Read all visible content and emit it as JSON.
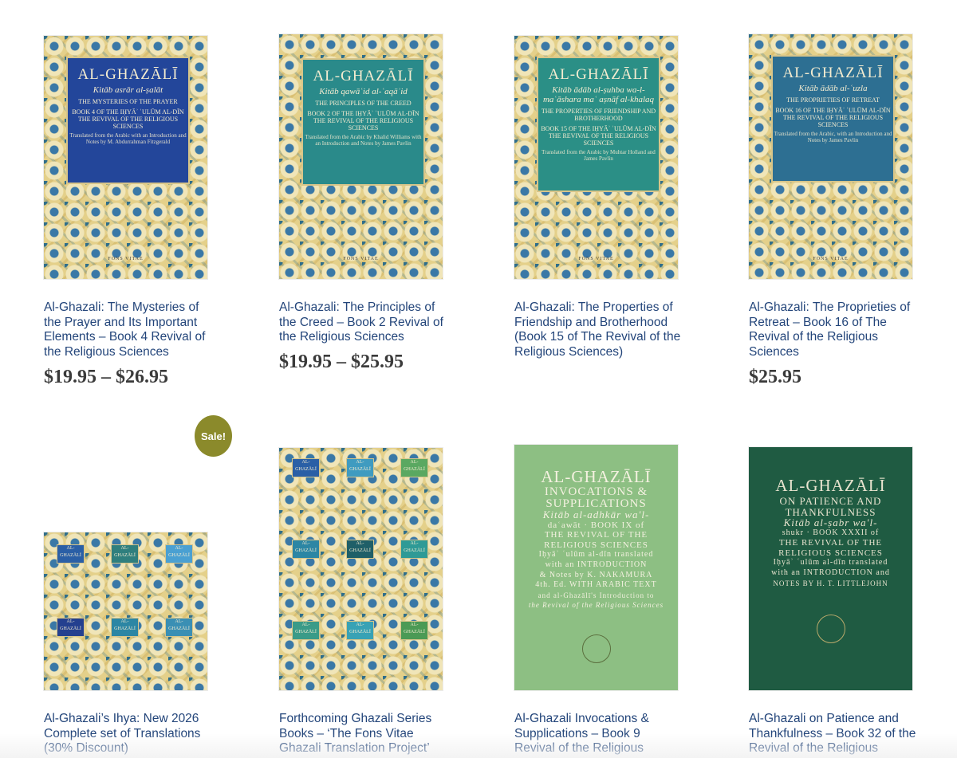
{
  "products": [
    {
      "title": "Al-Ghazali: The Mysteries of the Prayer and Its Important Elements – Book 4 Revival of the Religious Sciences",
      "price": "$19.95 – $26.95",
      "cover": {
        "author": "AL-GHAZĀLĪ",
        "subtitle": "Kitāb asrār al-ṣalāt",
        "heading": "THE MYSTERIES OF THE PRAYER",
        "series": "Book 4 of the Iḥyāʾ ʿulūm al-dīn THE REVIVAL OF THE RELIGIOUS SCIENCES",
        "credit": "Translated from the Arabic with an Introduction and Notes by M. Abdurrahman Fitzgerald",
        "publisher": "FONS VITAE",
        "panel_color": "#23469a"
      }
    },
    {
      "title": "Al-Ghazali: The Principles of the Creed – Book 2 Revival of the Religious Sciences",
      "price": "$19.95 – $25.95",
      "cover": {
        "author": "AL-GHAZĀLĪ",
        "subtitle": "Kitāb qawāʿid al-ʿaqāʾid",
        "heading": "THE PRINCIPLES OF THE CREED",
        "series": "Book 2 of the Iḥyāʾ ʿulūm al-dīn THE REVIVAL OF THE RELIGIOUS SCIENCES",
        "credit": "Translated from the Arabic by Khalid Williams with an Introduction and Notes by James Pavlin",
        "publisher": "FONS VITAE",
        "panel_color": "#2a8a8a"
      }
    },
    {
      "title": "Al-Ghazali: The Properties of Friendship and Brotherhood (Book 15 of The Revival of the Religious Sciences)",
      "price": "",
      "cover": {
        "author": "AL-GHAZĀLĪ",
        "subtitle": "Kitāb ādāb al-ṣuhba wa-l-maʿāshara maʿ aṣnāf al-khalaq",
        "heading": "THE PROPERTIES OF FRIENDSHIP AND BROTHERHOOD",
        "series": "Book 15 of the Iḥyāʾ ʿulūm al-dīn THE REVIVAL OF THE RELIGIOUS SCIENCES",
        "credit": "Translated from the Arabic by Muhtar Holland and James Pavlin",
        "publisher": "FONS VITAE",
        "panel_color": "#2b8f86"
      }
    },
    {
      "title": "Al-Ghazali: The Proprieties of Retreat – Book 16 of The Revival of the Religious Sciences",
      "price": "$25.95",
      "cover": {
        "author": "AL-GHAZĀLĪ",
        "subtitle": "Kitāb ādāb al-ʿuzla",
        "heading": "THE PROPRIETIES OF RETREAT",
        "series": "Book 16 of the Iḥyāʾ ʿulūm al-dīn THE REVIVAL OF THE RELIGIOUS SCIENCES",
        "credit": "Translated from the Arabic, with an Introduction and Notes by James Pavlin",
        "publisher": "FONS VITAE",
        "panel_color": "#2d6f92"
      }
    },
    {
      "title": "Al-Ghazali’s Ihya: New 2026 Complete set of Translations (30% Discount)",
      "badge": "Sale!",
      "cover": {
        "mini_label": "AL-GHAZĀLĪ"
      }
    },
    {
      "title": "Forthcoming Ghazali Series Books – ‘The Fons Vitae Ghazali Translation Project’",
      "cover": {
        "mini_label": "AL-GHAZĀLĪ"
      }
    },
    {
      "title": "Al-Ghazali Invocations & Supplications – Book 9 Revival of the Religious",
      "cover": {
        "lines": [
          "AL-GHAZĀLĪ",
          "INVOCATIONS &",
          "SUPPLICATIONS",
          "Kitāb al-adhkār wa'l-",
          "daʿawāt · BOOK IX of",
          "THE REVIVAL OF THE",
          "RELIGIOUS SCIENCES",
          "Iḥyāʾ ʿulūm al-dīn translated",
          "with an INTRODUCTION",
          "& Notes by K. NAKAMURA",
          "4th. Ed. WITH ARABIC TEXT",
          "and al-Ghazālī's Introduction to",
          "the Revival of the Religious Sciences"
        ],
        "bg": "#8dbf83",
        "ink": "#f4f1e0"
      }
    },
    {
      "title": "Al-Ghazali on Patience and Thankfulness – Book 32 of the Revival of the Religious",
      "cover": {
        "lines": [
          "AL-GHAZĀLĪ",
          "ON PATIENCE AND",
          "THANKFULNESS",
          "Kitāb al-ṣabr wa'l-",
          "shukr · BOOK XXXII of",
          "THE REVIVAL OF THE",
          "RELIGIOUS SCIENCES",
          "Iḥyāʾ ʿulūm al-dīn translated",
          "with an INTRODUCTION and",
          "NOTES BY H. T. LITTLEJOHN"
        ],
        "bg": "#1f5b42",
        "ink": "#e9e4cf"
      }
    }
  ]
}
